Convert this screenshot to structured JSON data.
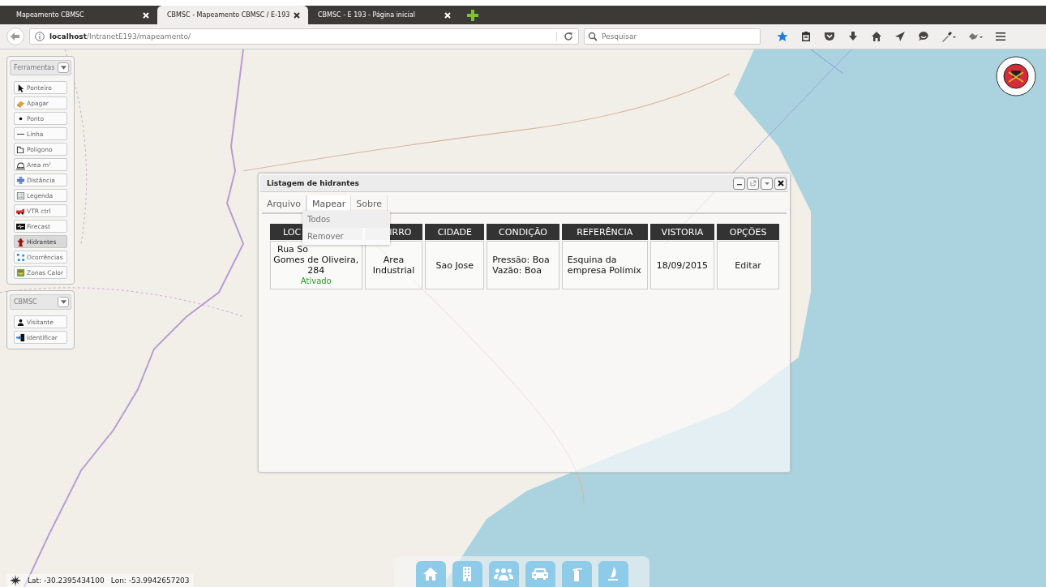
{
  "browser": {
    "tabs": [
      {
        "title": "Mapeamento CBMSC",
        "selected": false
      },
      {
        "title": "CBMSC - Mapeamento CBMSC / E-193",
        "selected": true
      },
      {
        "title": "CBMSC - E 193 - Página inicial",
        "selected": false
      }
    ],
    "url": "**localhost**/IntranetE193/mapeamento/",
    "search": {
      "placeholder": "Pesquisar"
    }
  },
  "tools_panel": {
    "title": "Ferramentas",
    "items": [
      {
        "label": "Ponteiro",
        "selected": false
      },
      {
        "label": "Apagar",
        "selected": false
      },
      {
        "label": "Ponto",
        "selected": false
      },
      {
        "label": "Linha",
        "selected": false
      },
      {
        "label": "Poligono",
        "selected": false
      },
      {
        "label": "Area m²",
        "selected": false
      },
      {
        "label": "Distância",
        "selected": false
      },
      {
        "label": "Legenda",
        "selected": false
      },
      {
        "label": "VTR ctrl",
        "selected": false
      },
      {
        "label": "Firecast",
        "selected": false
      },
      {
        "label": "Hidrantes",
        "selected": true
      },
      {
        "label": "Ocorrências",
        "selected": false
      },
      {
        "label": "Zonas Calor",
        "selected": false
      }
    ]
  },
  "user_panel": {
    "title": "CBMSC",
    "items": [
      {
        "label": "Visitante"
      },
      {
        "label": "Identificar"
      }
    ]
  },
  "dialog": {
    "title": "Listagem de hidrantes",
    "menu": [
      {
        "label": "Arquivo",
        "selected": false
      },
      {
        "label": "Mapear",
        "selected": true
      },
      {
        "label": "Sobre",
        "selected": false
      }
    ],
    "dropdown": [
      "Todos",
      "Remover"
    ],
    "table": {
      "columns": [
        "LOC",
        "IRRO",
        "CIDADE",
        "CONDIÇÃO",
        "REFERÊNCIA",
        "VISTORIA",
        "OPÇÕES"
      ],
      "rows": [
        {
          "local": [
            "Rua So",
            "Gomes de Oliveira,",
            "284"
          ],
          "status": "Ativado",
          "bairro": [
            "Area",
            "Industrial"
          ],
          "cidade": [
            "Sao Jose"
          ],
          "condicao": [
            "Pressão: Boa",
            "Vazão: Boa"
          ],
          "referencia": [
            "Esquina da",
            "empresa Polimix"
          ],
          "vistoria": [
            "18/09/2015"
          ],
          "action": "Editar"
        }
      ]
    }
  },
  "status_bar": {
    "lat": "Lat: -30.2395434100",
    "lon": "Lon: -53.9942657203"
  }
}
